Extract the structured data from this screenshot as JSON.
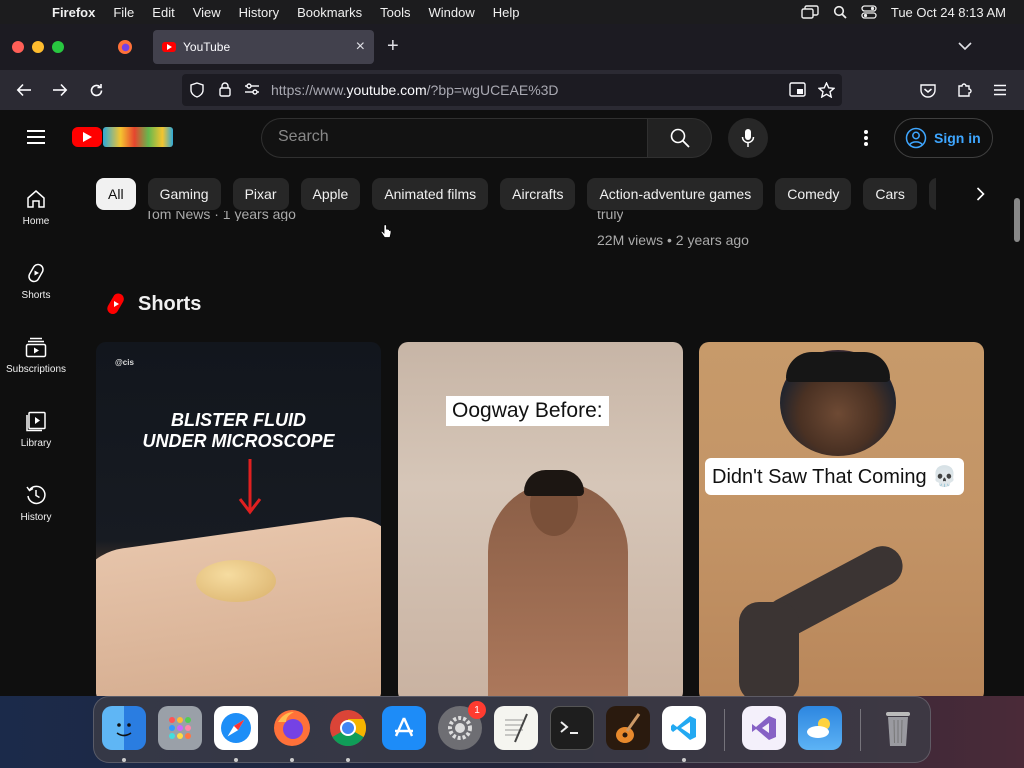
{
  "menubar": {
    "app_name": "Firefox",
    "items": [
      "File",
      "Edit",
      "View",
      "History",
      "Bookmarks",
      "Tools",
      "Window",
      "Help"
    ],
    "clock": "Tue Oct 24  8:13 AM"
  },
  "browser": {
    "active_tab_title": "YouTube",
    "url_prefix": "https://www.",
    "url_domain": "youtube.com",
    "url_suffix": "/?bp=wgUCEAE%3D"
  },
  "youtube": {
    "search_placeholder": "Search",
    "sign_in_label": "Sign in",
    "chips": [
      "All",
      "Gaming",
      "Pixar",
      "Apple",
      "Animated films",
      "Aircrafts",
      "Action-adventure games",
      "Comedy",
      "Cars"
    ],
    "sidebar": [
      {
        "label": "Home",
        "icon": "home-icon"
      },
      {
        "label": "Shorts",
        "icon": "shorts-icon"
      },
      {
        "label": "Subscriptions",
        "icon": "subscriptions-icon"
      },
      {
        "label": "Library",
        "icon": "library-icon"
      },
      {
        "label": "History",
        "icon": "history-icon"
      }
    ],
    "partial_meta_left": "Tom News · 1 years ago",
    "partial_title_right": "truly",
    "video_meta_right": "22M views • 2 years ago",
    "shorts_title": "Shorts",
    "shorts": [
      {
        "channel": "@cis",
        "overlay_text": "BLISTER FLUID\nUNDER MICROSCOPE"
      },
      {
        "overlay_text": "Oogway Before:"
      },
      {
        "overlay_text": "Didn't Saw That Coming 💀"
      }
    ]
  },
  "dock": {
    "apps": [
      "Finder",
      "Launchpad",
      "Safari",
      "Firefox",
      "Chrome",
      "App Store",
      "System Settings",
      "TextEdit",
      "Terminal",
      "GarageBand",
      "Visual Studio Code",
      "Visual Studio",
      "Weather",
      "Trash"
    ],
    "settings_badge": "1"
  },
  "colors": {
    "youtube_red": "#ff0000",
    "link_blue": "#3ea6ff",
    "page_bg": "#0f0f0f"
  }
}
